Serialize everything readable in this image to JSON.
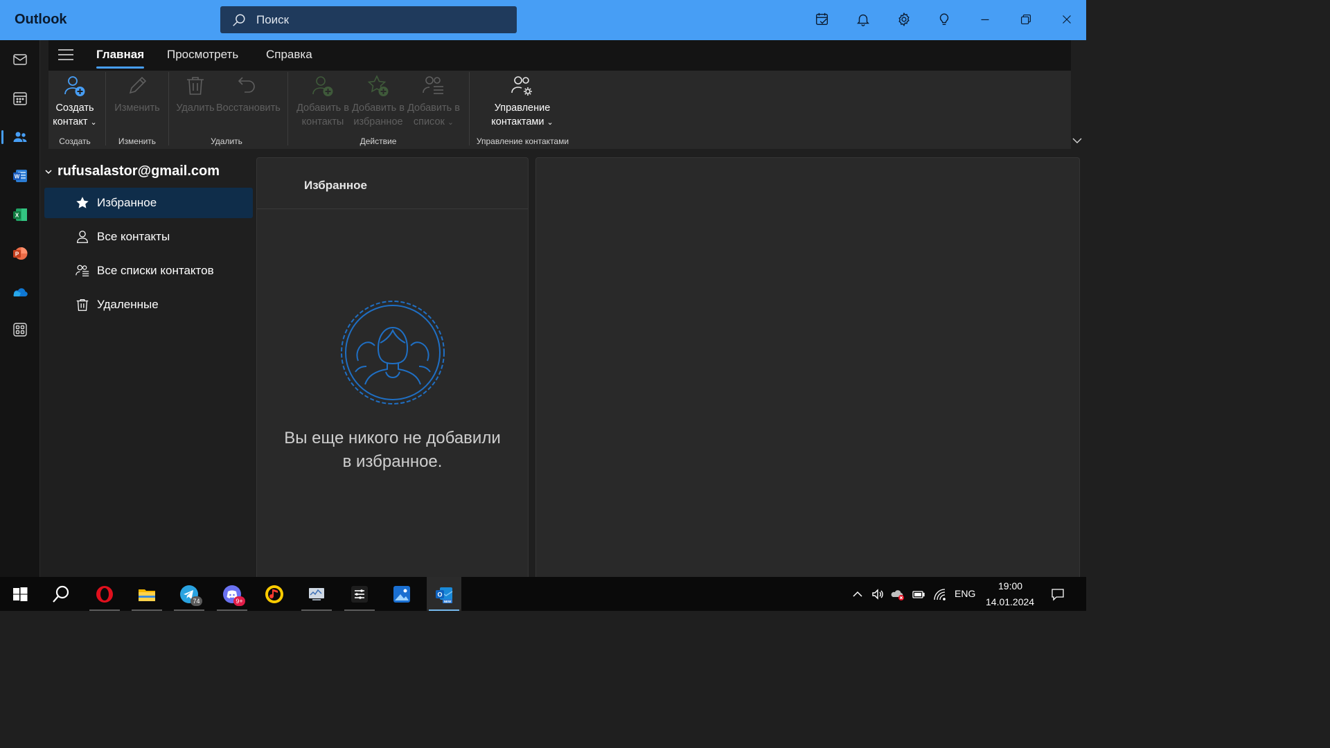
{
  "app": {
    "title": "Outlook"
  },
  "search": {
    "placeholder": "Поиск"
  },
  "titlebar_icons": [
    "todo-icon",
    "bell-icon",
    "gear-icon",
    "lightbulb-icon",
    "minimize-icon",
    "restore-icon",
    "close-icon"
  ],
  "left_rail": [
    "mail-icon",
    "calendar-icon",
    "people-icon",
    "word-icon",
    "excel-icon",
    "powerpoint-icon",
    "onedrive-icon",
    "apps-icon"
  ],
  "menu": {
    "tabs": [
      {
        "label": "Главная",
        "active": true
      },
      {
        "label": "Просмотреть",
        "active": false
      },
      {
        "label": "Справка",
        "active": false
      }
    ]
  },
  "ribbon": {
    "create_contact": {
      "line1": "Создать",
      "line2": "контакт"
    },
    "edit": "Изменить",
    "delete": "Удалить",
    "restore": "Восстановить",
    "add_to_contacts": {
      "line1": "Добавить в",
      "line2": "контакты"
    },
    "add_to_favorites": {
      "line1": "Добавить в",
      "line2": "избранное"
    },
    "add_to_list": {
      "line1": "Добавить в",
      "line2": "список"
    },
    "manage_contacts": {
      "line1": "Управление",
      "line2": "контактами"
    },
    "groups": {
      "create": "Создать",
      "edit": "Изменить",
      "delete": "Удалить",
      "action": "Действие",
      "manage": "Управление контактами"
    }
  },
  "folders": {
    "account": "rufusalastor@gmail.com",
    "items": [
      {
        "label": "Избранное",
        "icon": "star-icon",
        "selected": true
      },
      {
        "label": "Все контакты",
        "icon": "person-icon",
        "selected": false
      },
      {
        "label": "Все списки контактов",
        "icon": "people-list-icon",
        "selected": false
      },
      {
        "label": "Удаленные",
        "icon": "trash-icon",
        "selected": false
      }
    ]
  },
  "list": {
    "title": "Избранное",
    "empty_text_line1": "Вы еще никого не добавили",
    "empty_text_line2": "в избранное."
  },
  "taskbar": {
    "apps": [
      "windows-start-icon",
      "search-icon",
      "opera-icon",
      "file-explorer-icon",
      "telegram-icon",
      "discord-icon",
      "music-app-icon",
      "monitor-app-icon",
      "settings-sliders-icon",
      "photos-icon",
      "outlook-new-icon"
    ],
    "telegram_badge": "74",
    "discord_badge": "9+",
    "language": "ENG",
    "time": "19:00",
    "date": "14.01.2024"
  },
  "colors": {
    "accent": "#479ef5",
    "titlebar": "#479ef5",
    "selected_folder": "#0f2d4a",
    "pane": "#292929",
    "background": "#1f1f1f"
  }
}
